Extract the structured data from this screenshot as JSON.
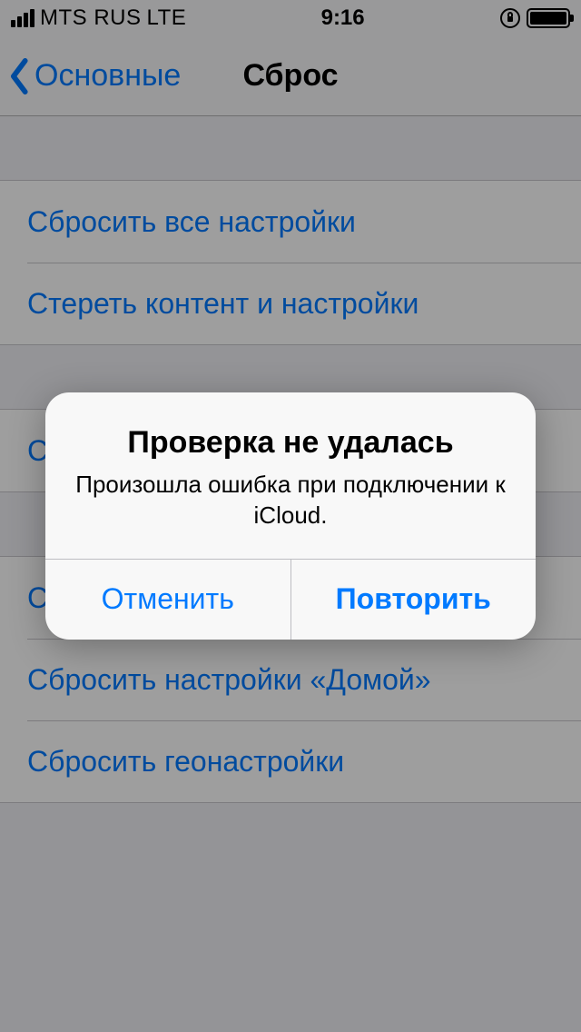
{
  "status": {
    "carrier": "MTS RUS",
    "network": "LTE",
    "time": "9:16"
  },
  "nav": {
    "back_label": "Основные",
    "title": "Сброс"
  },
  "groups": [
    {
      "rows": [
        "Сбросить все настройки",
        "Стереть контент и настройки"
      ]
    },
    {
      "rows": [
        "Сбросить настройки сети"
      ]
    },
    {
      "rows": [
        "Сбросить словарь клавиатуры",
        "Сбросить настройки «Домой»",
        "Сбросить геонастройки"
      ]
    }
  ],
  "alert": {
    "title": "Проверка не удалась",
    "message": "Произошла ошибка при подключении к iCloud.",
    "cancel": "Отменить",
    "retry": "Повторить"
  }
}
